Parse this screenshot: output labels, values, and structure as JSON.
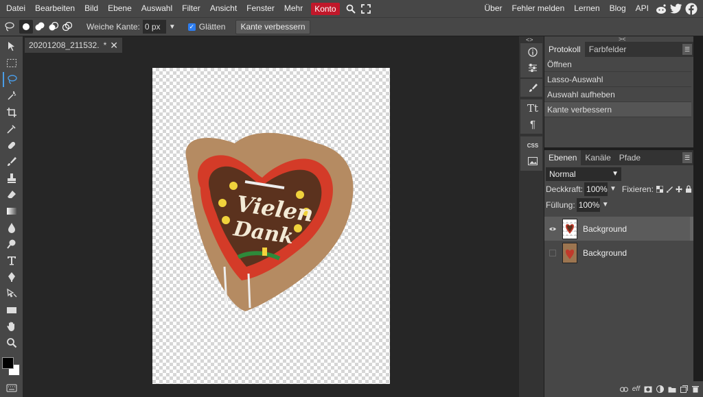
{
  "menubar": {
    "items": [
      "Datei",
      "Bearbeiten",
      "Bild",
      "Ebene",
      "Auswahl",
      "Filter",
      "Ansicht",
      "Fenster",
      "Mehr"
    ],
    "account_label": "Konto",
    "links": [
      "Über",
      "Fehler melden",
      "Lernen",
      "Blog",
      "API"
    ]
  },
  "options": {
    "feather_label": "Weiche Kante:",
    "feather_value": "0 px",
    "antialias_label": "Glätten",
    "antialias_checked": true,
    "refine_edge_label": "Kante verbessern"
  },
  "document": {
    "tab_title": "20201208_211532.",
    "modified_mark": "*"
  },
  "strip_text": {
    "type_icon": "Tt",
    "paragraph_icon": "¶",
    "css_label": "CSS"
  },
  "history_panel": {
    "tabs": [
      "Protokoll",
      "Farbfelder"
    ],
    "items": [
      "Öffnen",
      "Lasso-Auswahl",
      "Auswahl aufheben",
      "Kante verbessern"
    ],
    "current_index": 3
  },
  "layers_panel": {
    "tabs": [
      "Ebenen",
      "Kanäle",
      "Pfade"
    ],
    "blend_mode": "Normal",
    "opacity_label": "Deckkraft:",
    "opacity_value": "100%",
    "lock_label": "Fixieren:",
    "fill_label": "Füllung:",
    "fill_value": "100%",
    "layers": [
      {
        "name": "Background",
        "visible": true,
        "selected": true
      },
      {
        "name": "Background",
        "visible": false,
        "selected": false
      }
    ],
    "footer_eff": "eff"
  },
  "image_text": {
    "line1": "Vielen",
    "line2": "Dank"
  },
  "colors": {
    "accent": "#c0182a",
    "selection_blue": "#4a9de8",
    "annotation_red": "#e8192c",
    "foreground": "#000000",
    "background": "#ffffff"
  }
}
